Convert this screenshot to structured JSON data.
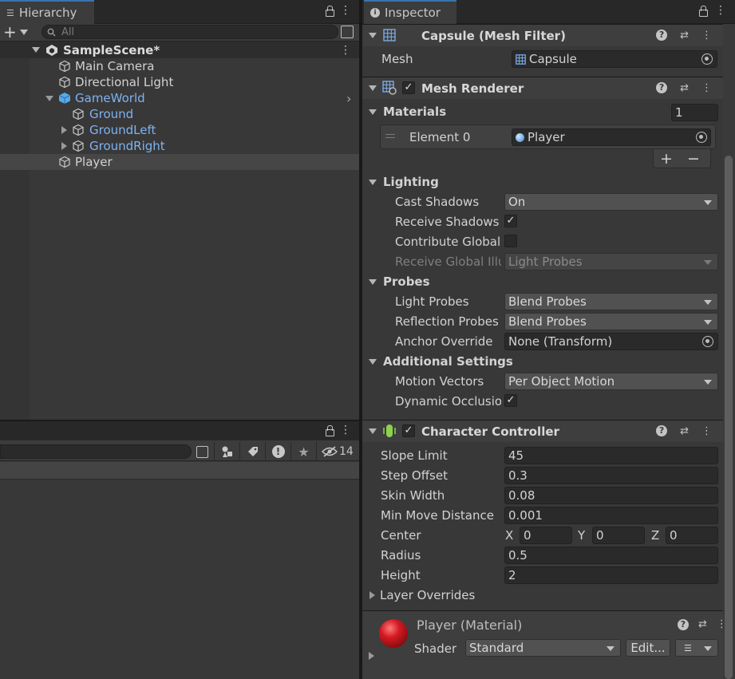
{
  "hierarchy": {
    "tab_label": "Hierarchy",
    "search_placeholder": "All",
    "scene_name": "SampleScene*",
    "items": [
      {
        "label": "Main Camera"
      },
      {
        "label": "Directional Light"
      },
      {
        "label": "GameWorld"
      },
      {
        "label": "Ground"
      },
      {
        "label": "GroundLeft"
      },
      {
        "label": "GroundRight"
      },
      {
        "label": "Player"
      }
    ]
  },
  "project": {
    "hidden_count": "14"
  },
  "inspector": {
    "tab_label": "Inspector",
    "mesh_filter": {
      "title": "Capsule (Mesh Filter)",
      "mesh_label": "Mesh",
      "mesh_value": "Capsule"
    },
    "mesh_renderer": {
      "title": "Mesh Renderer",
      "materials_label": "Materials",
      "materials_count": "1",
      "element_label": "Element 0",
      "element_value": "Player",
      "add_label": "+",
      "remove_label": "−",
      "lighting_label": "Lighting",
      "cast_shadows_label": "Cast Shadows",
      "cast_shadows_value": "On",
      "receive_shadows_label": "Receive Shadows",
      "contribute_gi_label": "Contribute Global I",
      "receive_gi_label": "Receive Global Illu",
      "receive_gi_value": "Light Probes",
      "probes_label": "Probes",
      "light_probes_label": "Light Probes",
      "light_probes_value": "Blend Probes",
      "reflection_probes_label": "Reflection Probes",
      "reflection_probes_value": "Blend Probes",
      "anchor_override_label": "Anchor Override",
      "anchor_override_value": "None (Transform)",
      "additional_label": "Additional Settings",
      "motion_vectors_label": "Motion Vectors",
      "motion_vectors_value": "Per Object Motion",
      "dynamic_occlusion_label": "Dynamic Occlusio"
    },
    "character_controller": {
      "title": "Character Controller",
      "slope_limit_label": "Slope Limit",
      "slope_limit_value": "45",
      "step_offset_label": "Step Offset",
      "step_offset_value": "0.3",
      "skin_width_label": "Skin Width",
      "skin_width_value": "0.08",
      "min_move_label": "Min Move Distance",
      "min_move_value": "0.001",
      "center_label": "Center",
      "center_x_label": "X",
      "center_x": "0",
      "center_y_label": "Y",
      "center_y": "0",
      "center_z_label": "Z",
      "center_z": "0",
      "radius_label": "Radius",
      "radius_value": "0.5",
      "height_label": "Height",
      "height_value": "2",
      "layer_overrides_label": "Layer Overrides"
    },
    "material": {
      "title": "Player (Material)",
      "shader_label": "Shader",
      "shader_value": "Standard",
      "edit_label": "Edit...",
      "color": "#c0141c"
    }
  },
  "colors": {
    "accent_blue": "#7fb2f0",
    "highlight_tab": "#3a72b0"
  }
}
